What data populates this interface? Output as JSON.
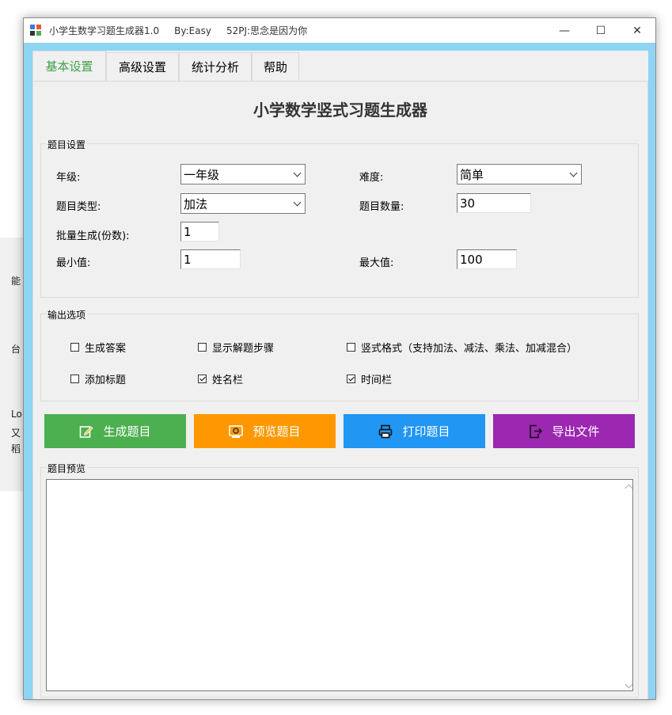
{
  "window": {
    "title": "小学生数学习题生成器1.0     By:Easy     52PJ:思念是因为你",
    "minimize": "—",
    "maximize": "☐",
    "close": "✕"
  },
  "background": {
    "fragments": [
      "能",
      "台",
      "Lo",
      "又",
      "稻"
    ]
  },
  "tabs": [
    {
      "label": "基本设置",
      "active": true
    },
    {
      "label": "高级设置",
      "active": false
    },
    {
      "label": "统计分析",
      "active": false
    },
    {
      "label": "帮助",
      "active": false
    }
  ],
  "main_title": "小学数学竖式习题生成器",
  "question_settings": {
    "group_label": "题目设置",
    "grade_label": "年级:",
    "grade_value": "一年级",
    "difficulty_label": "难度:",
    "difficulty_value": "简单",
    "type_label": "题目类型:",
    "type_value": "加法",
    "count_label": "题目数量:",
    "count_value": "30",
    "batch_label": "批量生成(份数):",
    "batch_value": "1",
    "min_label": "最小值:",
    "min_value": "1",
    "max_label": "最大值:",
    "max_value": "100"
  },
  "output_options": {
    "group_label": "输出选项",
    "items": [
      {
        "label": "生成答案",
        "checked": false
      },
      {
        "label": "显示解题步骤",
        "checked": false
      },
      {
        "label": "竖式格式（支持加法、减法、乘法、加减混合）",
        "checked": false
      },
      {
        "label": "添加标题",
        "checked": false
      },
      {
        "label": "姓名栏",
        "checked": true
      },
      {
        "label": "时间栏",
        "checked": true
      }
    ]
  },
  "actions": [
    {
      "label": "生成题目",
      "icon": "edit-icon",
      "color": "#4caf50"
    },
    {
      "label": "预览题目",
      "icon": "preview-icon",
      "color": "#ff9800"
    },
    {
      "label": "打印题目",
      "icon": "printer-icon",
      "color": "#2196f3"
    },
    {
      "label": "导出文件",
      "icon": "export-icon",
      "color": "#9c27b0"
    }
  ],
  "preview": {
    "group_label": "题目预览",
    "content": ""
  }
}
